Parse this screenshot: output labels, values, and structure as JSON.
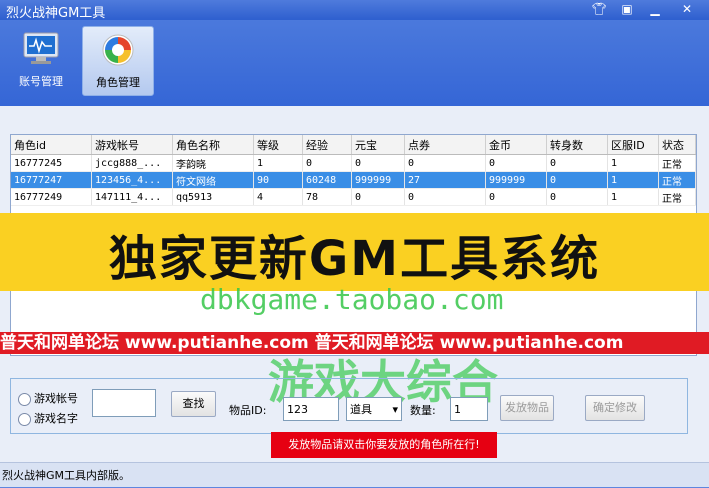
{
  "window": {
    "title": "烈火战神GM工具"
  },
  "toolbar": [
    {
      "label": "账号管理",
      "icon": "monitor-icon"
    },
    {
      "label": "角色管理",
      "icon": "refresh-globe-icon",
      "active": true
    }
  ],
  "table": {
    "columns": [
      "角色id",
      "游戏帐号",
      "角色名称",
      "等级",
      "经验",
      "元宝",
      "点券",
      "金币",
      "转身数",
      "区服ID",
      "状态"
    ],
    "rows": [
      [
        "16777245",
        "jccg888_...",
        "李韵晓",
        "1",
        "0",
        "0",
        "0",
        "0",
        "0",
        "1",
        "正常"
      ],
      [
        "16777247",
        "123456_4...",
        "符文网络",
        "90",
        "60248",
        "999999",
        "27",
        "999999",
        "0",
        "1",
        "正常"
      ],
      [
        "16777249",
        "147111_4...",
        "qq5913",
        "4",
        "78",
        "0",
        "0",
        "0",
        "0",
        "1",
        "正常"
      ]
    ],
    "selected_row": 1
  },
  "overlay": {
    "banner_text": "独家更新GM工具系统",
    "watermark_url": "dbkgame.taobao.com",
    "red_strip": "普天和网单论坛  www.putianhe.com  普天和网单论坛  www.putianhe.com",
    "watermark_big": "游戏大综合"
  },
  "search": {
    "radio_account": "游戏帐号",
    "radio_name": "游戏名字",
    "search_value": "",
    "search_button": "查找"
  },
  "item": {
    "id_label": "物品ID:",
    "id_value": "123",
    "type_value": "道具",
    "qty_label": "数量:",
    "qty_value": "1",
    "send_button": "发放物品",
    "confirm_button": "确定修改"
  },
  "tip": "发放物品请双击你要发放的角色所在行!",
  "status": "烈火战神GM工具内部版。",
  "colors": {
    "accent": "#3566d6",
    "selected": "#3a8ee6",
    "banner": "#fad022",
    "tip": "#e60012"
  }
}
